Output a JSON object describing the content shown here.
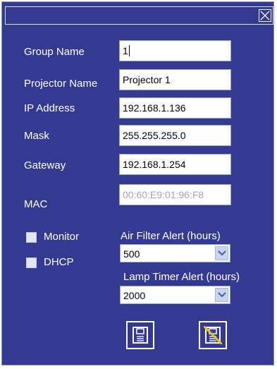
{
  "labels": {
    "group_name": "Group Name",
    "projector_name": "Projector Name",
    "ip_address": "IP Address",
    "mask": "Mask",
    "gateway": "Gateway",
    "mac": "MAC",
    "monitor": "Monitor",
    "dhcp": "DHCP",
    "air_filter_alert": "Air Filter Alert (hours)",
    "lamp_timer_alert": "Lamp Timer Alert (hours)"
  },
  "fields": {
    "group_name": "1",
    "projector_name": "Projector 1",
    "ip_address": "192.168.1.136",
    "mask": "255.255.255.0",
    "gateway": "192.168.1.254",
    "mac": "00:60:E9:01:96:F8"
  },
  "selects": {
    "air_filter_alert": "500",
    "lamp_timer_alert": "2000"
  },
  "checkboxes": {
    "monitor": false,
    "dhcp": false
  },
  "icons": {
    "close": "close-x-icon",
    "save": "floppy-save-icon",
    "discard": "floppy-cancel-icon"
  },
  "colors": {
    "background": "#343a92",
    "text": "#ffffff",
    "disabled_text": "#a0a4b8",
    "cancel_slash": "#e0c020"
  }
}
